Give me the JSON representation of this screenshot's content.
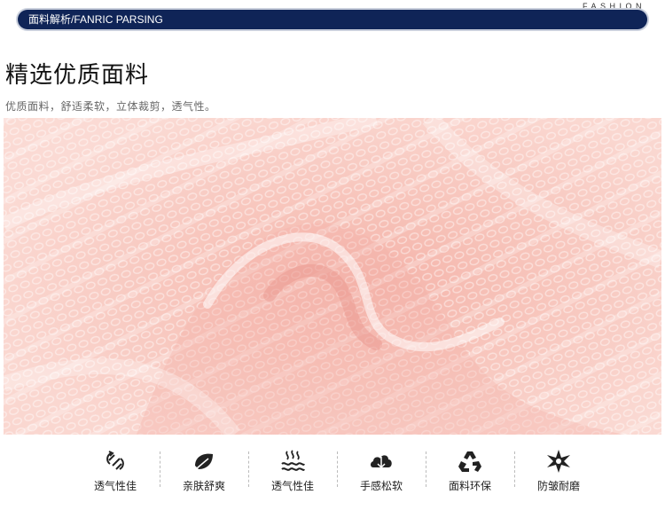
{
  "header": {
    "fashion_label": "FASHION",
    "banner_title": "面料解析",
    "banner_subtitle": "/FANRIC PARSING"
  },
  "section": {
    "title": "精选优质面料",
    "subtitle": "优质面料，舒适柔软，立体裁剪，透气性。"
  },
  "features": [
    {
      "label": "透气性佳",
      "icon": "airflow-icon"
    },
    {
      "label": "亲肤舒爽",
      "icon": "leaf-icon"
    },
    {
      "label": "透气性佳",
      "icon": "steam-icon"
    },
    {
      "label": "手感松软",
      "icon": "cloud-icon"
    },
    {
      "label": "面料环保",
      "icon": "recycle-icon"
    },
    {
      "label": "防皱耐磨",
      "icon": "star-icon"
    }
  ],
  "colors": {
    "banner": "#0f2457",
    "fabric": "#f7c9c1"
  }
}
